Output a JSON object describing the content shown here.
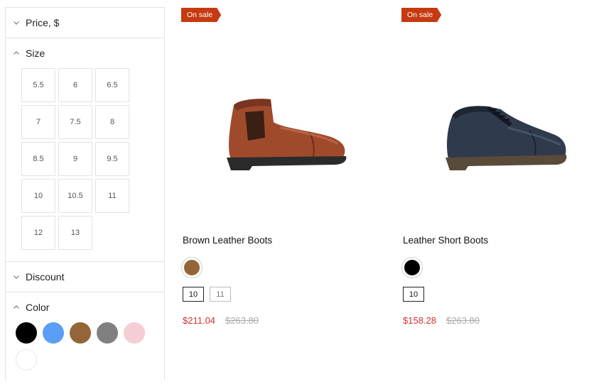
{
  "filters": {
    "price": {
      "label": "Price, $"
    },
    "size": {
      "label": "Size",
      "options": [
        "5.5",
        "6",
        "6.5",
        "7",
        "7.5",
        "8",
        "8.5",
        "9",
        "9.5",
        "10",
        "10.5",
        "11",
        "12",
        "13"
      ]
    },
    "discount": {
      "label": "Discount"
    },
    "color": {
      "label": "Color",
      "swatches": [
        "#000000",
        "#5b9ef7",
        "#946536",
        "#808080",
        "#f5cdd4",
        "#ffffff"
      ]
    }
  },
  "products": [
    {
      "badge": "On sale",
      "name": "Brown Leather Boots",
      "color": "#946536",
      "sizes": [
        "10",
        "11"
      ],
      "sale_price": "$211.04",
      "old_price": "$263.80"
    },
    {
      "badge": "On sale",
      "name": "Leather Short Boots",
      "color": "#000000",
      "sizes": [
        "10"
      ],
      "sale_price": "$158.28",
      "old_price": "$263.80"
    }
  ]
}
